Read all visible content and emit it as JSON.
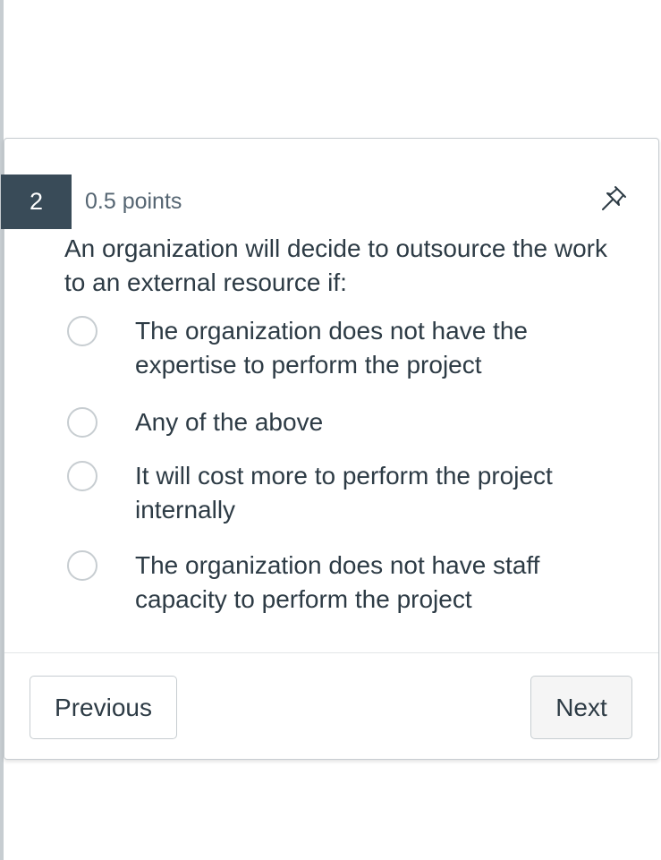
{
  "question": {
    "number": "2",
    "points": "0.5 points",
    "text": "An organization will decide to outsource the work to an external resource if:",
    "pin_icon": "pin-icon",
    "options": [
      {
        "label": "The organization does not have the expertise to perform the project",
        "selected": false
      },
      {
        "label": "Any of the above",
        "selected": false
      },
      {
        "label": "It will cost more to perform the project internally",
        "selected": false
      },
      {
        "label": "The organization does not have staff capacity to perform the project",
        "selected": false
      }
    ]
  },
  "nav": {
    "previous_label": "Previous",
    "next_label": "Next"
  },
  "colors": {
    "badge_bg": "#394b58",
    "text": "#2d3b45",
    "border": "#c7cdd1"
  }
}
